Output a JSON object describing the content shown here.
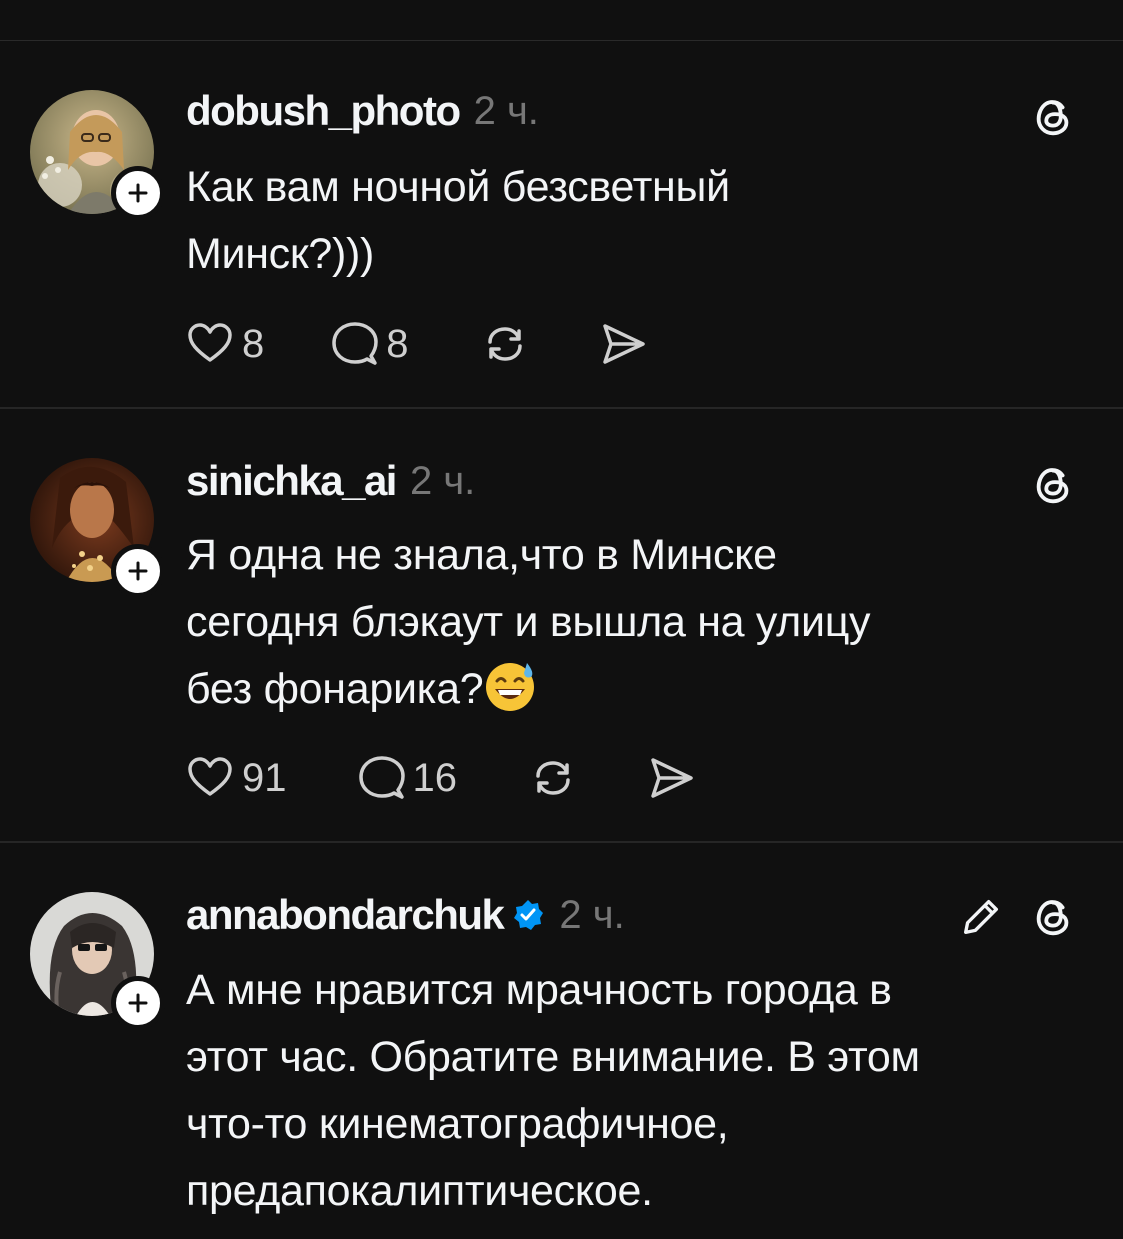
{
  "posts": [
    {
      "username": "dobush_photo",
      "time": "2 ч.",
      "text_lines": [
        "Как вам ночной безсветный",
        "Минск?)))"
      ],
      "likes": "8",
      "replies": "8",
      "verified": false
    },
    {
      "username": "sinichka_ai",
      "time": "2 ч.",
      "text_lines": [
        "Я одна не знала,что в Минске",
        "сегодня блэкаут и вышла на улицу",
        "без фонарика?"
      ],
      "emoji": "grinning-sweat-emoji",
      "likes": "91",
      "replies": "16",
      "verified": false
    },
    {
      "username": "annabondarchuk",
      "time": "2 ч.",
      "text_lines": [
        "А мне нравится мрачность города в",
        "этот час. Обратите внимание. В этом",
        "что-то кинематографичное,",
        "предапокалиптическое."
      ],
      "verified": true
    }
  ],
  "icons": {
    "like": "heart-icon",
    "reply": "comment-icon",
    "repost": "repost-icon",
    "share": "send-icon",
    "brand": "threads-icon",
    "edit": "pencil-icon",
    "follow": "plus-icon",
    "verified": "verified-badge-icon"
  },
  "colors": {
    "background": "#101010",
    "text": "#f3f5f7",
    "muted": "#777777",
    "verified": "#0095f6"
  }
}
